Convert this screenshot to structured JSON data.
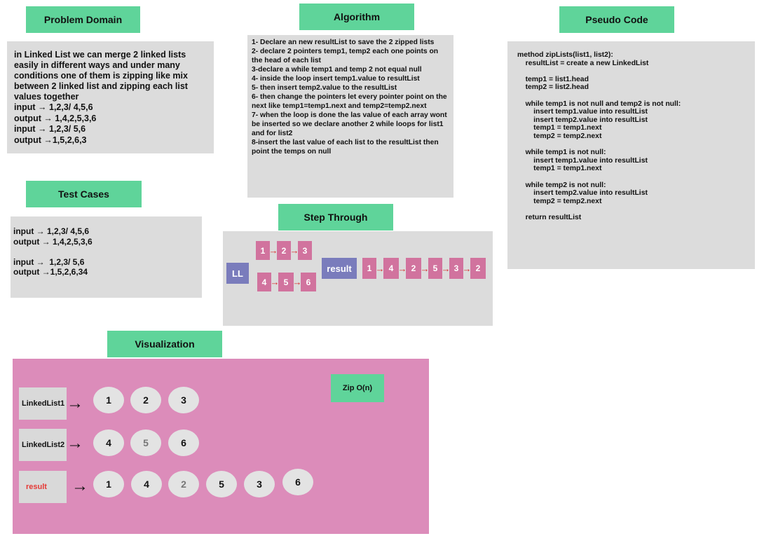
{
  "headers": {
    "problem_domain": "Problem Domain",
    "algorithm": "Algorithm",
    "pseudo_code": "Pseudo Code",
    "test_cases": "Test Cases",
    "step_through": "Step Through",
    "visualization": "Visualization"
  },
  "problem_domain": {
    "paragraph": "in Linked List we can merge 2 linked lists easily in different ways and under many conditions one of them is zipping like mix between 2 linked list and zipping each list values together",
    "examples": [
      "input → 1,2,3/ 4,5,6",
      "output → 1,4,2,5,3,6",
      "input →  1,2,3/ 5,6",
      "output →1,5,2,6,3"
    ]
  },
  "algorithm": {
    "text": "1- Declare an new resultList to save the 2 zipped lists\n2- declare 2 pointers temp1, temp2 each one points on the head of each list\n3-declare a while temp1 and temp 2 not equal null\n4- inside the loop insert temp1.value to resultList\n5- then insert temp2.value to the resultList\n6- then change the pointers let every pointer point on the next like temp1=temp1.next and temp2=temp2.next\n7- when the loop is done the las value of each array wont be inserted so we declare another 2 while loops for list1 and for list2\n8-insert the last value of each list to the resultList then point the temps on null"
  },
  "pseudo_code": {
    "text": "method zipLists(list1, list2):\n    resultList = create a new LinkedList\n\n    temp1 = list1.head\n    temp2 = list2.head\n\n    while temp1 is not null and temp2 is not null:\n        insert temp1.value into resultList\n        insert temp2.value into resultList\n        temp1 = temp1.next\n        temp2 = temp2.next\n\n    while temp1 is not null:\n        insert temp1.value into resultList\n        temp1 = temp1.next\n\n    while temp2 is not null:\n        insert temp2.value into resultList\n        temp2 = temp2.next\n\n    return resultList"
  },
  "test_cases": {
    "text": "input → 1,2,3/ 4,5,6\noutput → 1,4,2,5,3,6\n\ninput →  1,2,3/ 5,6\noutput →1,5,2,6,34"
  },
  "step_through": {
    "ll_label": "LL",
    "result_label": "result",
    "list1": [
      "1",
      "2",
      "3"
    ],
    "list2": [
      "4",
      "5",
      "6"
    ],
    "result": [
      "1",
      "4",
      "2",
      "5",
      "3",
      "2"
    ],
    "arrow": "→"
  },
  "visualization": {
    "complexity": "Zip O(n)",
    "arrow": "→",
    "rows": [
      {
        "label": "LinkedList1",
        "values": [
          "1",
          "2",
          "3"
        ]
      },
      {
        "label": "LinkedList2",
        "values": [
          "4",
          "5",
          "6"
        ]
      },
      {
        "label": "result",
        "values": [
          "1",
          "4",
          "2",
          "5",
          "3",
          "6"
        ]
      }
    ],
    "label_colors": {
      "default": "#111111",
      "result": "#e53935"
    },
    "panel_color": "#dc8cba"
  }
}
